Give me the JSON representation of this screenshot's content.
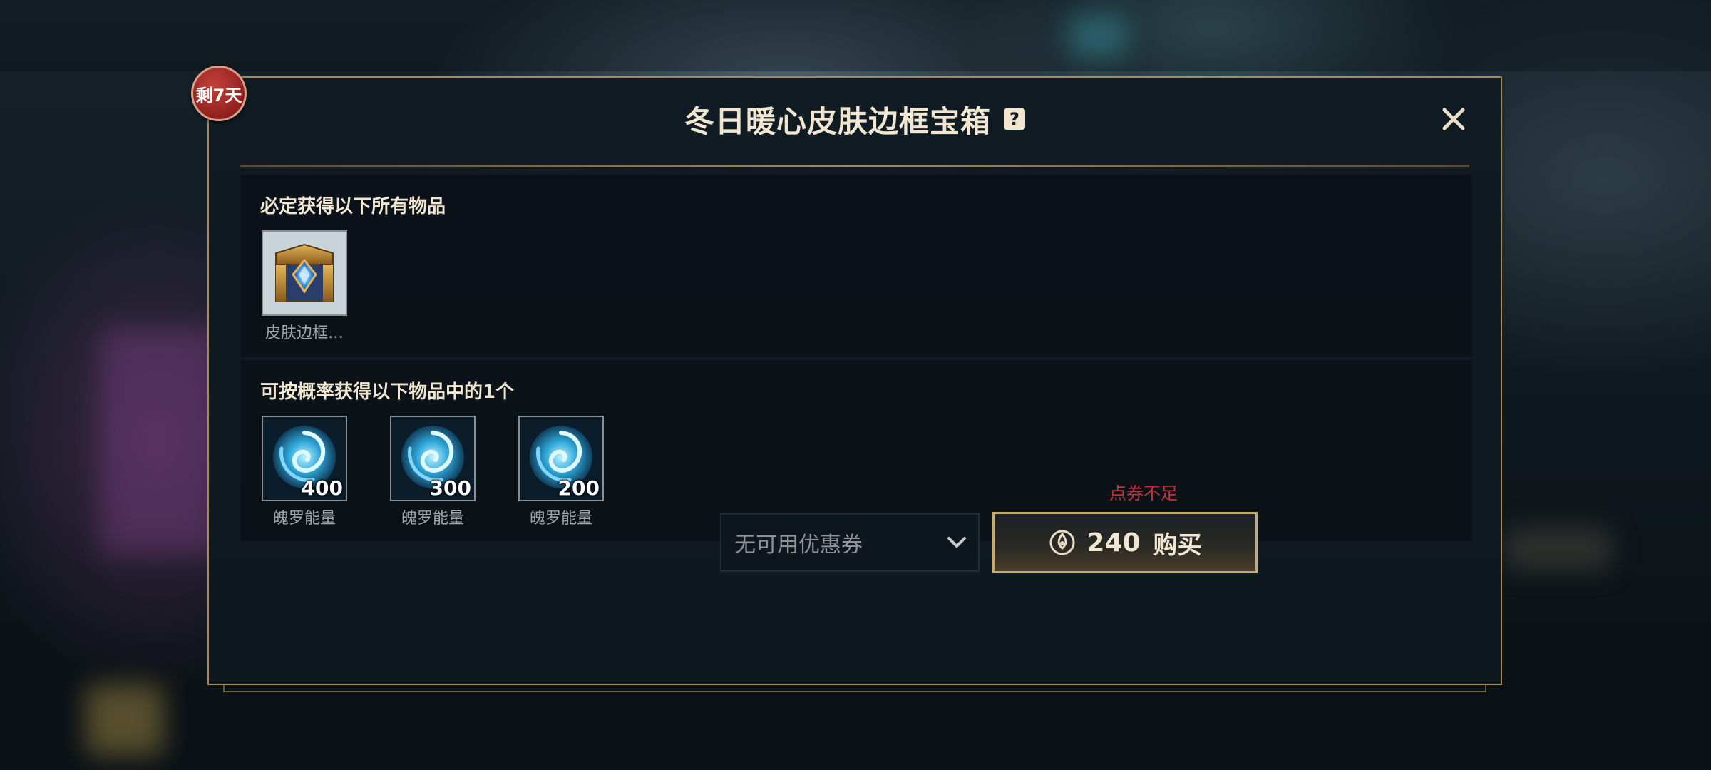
{
  "background": {
    "side_id": "47587685"
  },
  "modal": {
    "days_left_badge": "剩7天",
    "title": "冬日暖心皮肤边框宝箱",
    "help_icon": "?",
    "close_icon": "close-icon",
    "guaranteed": {
      "title": "必定获得以下所有物品",
      "items": [
        {
          "label": "皮肤边框…",
          "icon": "chest-icon"
        }
      ]
    },
    "random": {
      "title": "可按概率获得以下物品中的1个",
      "items": [
        {
          "label": "魄罗能量",
          "quantity": "400",
          "icon": "poro-energy-icon"
        },
        {
          "label": "魄罗能量",
          "quantity": "300",
          "icon": "poro-energy-icon"
        },
        {
          "label": "魄罗能量",
          "quantity": "200",
          "icon": "poro-energy-icon"
        }
      ]
    },
    "footer": {
      "insufficient_text": "点券不足",
      "coupon_select_value": "无可用优惠券",
      "buy_price": "240",
      "buy_label": "购买",
      "currency_icon": "points-currency-icon"
    }
  },
  "colors": {
    "gold_border": "#a8894f",
    "button_border": "#c8aa6e",
    "title_text": "#f0e6d2",
    "warning_red": "#c2313a",
    "badge_red": "#8d1f1d"
  }
}
